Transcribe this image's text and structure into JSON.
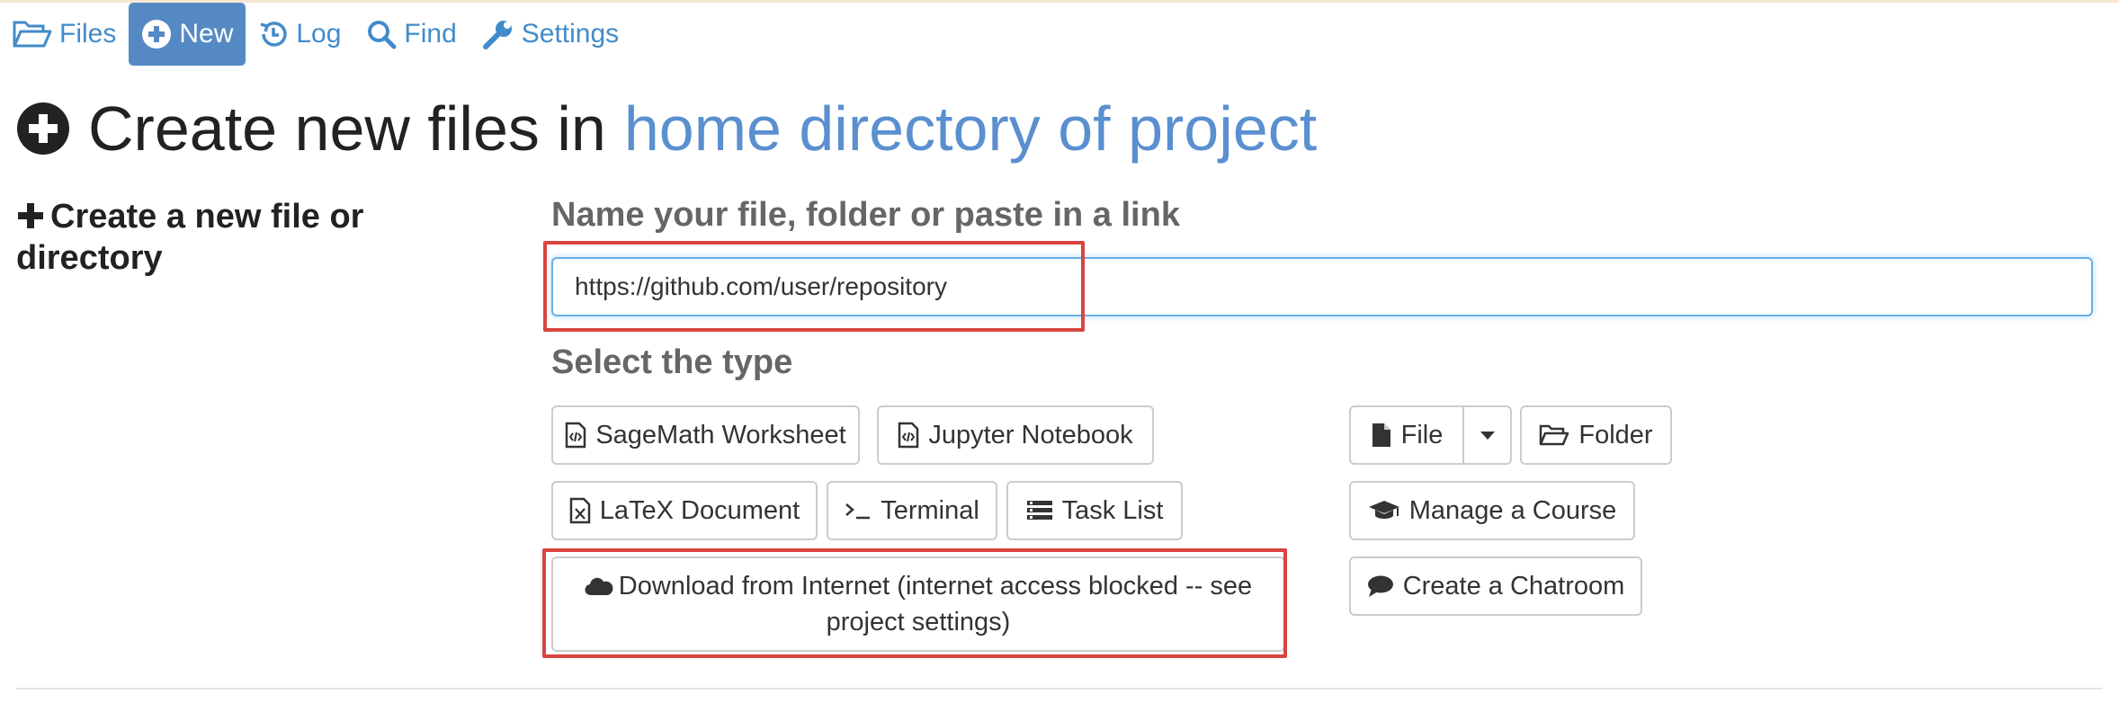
{
  "nav": {
    "files_label": "Files",
    "new_label": "New",
    "log_label": "Log",
    "find_label": "Find",
    "settings_label": "Settings"
  },
  "page": {
    "title_prefix": "Create new files in",
    "title_location": "home directory of project"
  },
  "sidebar": {
    "heading": "Create a new file or directory"
  },
  "form": {
    "name_label": "Name your file, folder or paste in a link",
    "name_value": "https://github.com/user/repository",
    "type_label": "Select the type"
  },
  "types": {
    "sagemath": "SageMath Worksheet",
    "jupyter": "Jupyter Notebook",
    "latex": "LaTeX Document",
    "terminal": "Terminal",
    "tasklist": "Task List",
    "download": "Download from Internet (internet access blocked -- see project settings)",
    "file": "File",
    "folder": "Folder",
    "course": "Manage a Course",
    "chatroom": "Create a Chatroom"
  },
  "colors": {
    "accent": "#5589c4",
    "link": "#428bca",
    "highlight": "#d9443e"
  }
}
